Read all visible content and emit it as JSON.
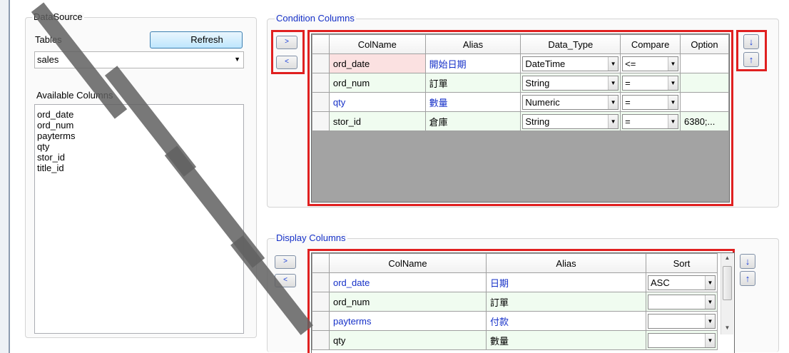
{
  "datasource": {
    "title": "DataSource",
    "tables_label": "Tables",
    "refresh_label": "Refresh",
    "table_value": "sales",
    "available_label": "Available Columns",
    "available_columns": [
      "ord_date",
      "ord_num",
      "payterms",
      "qty",
      "stor_id",
      "title_id"
    ]
  },
  "condition": {
    "title": "Condition Columns",
    "add_label": ">",
    "remove_label": "<",
    "down_label": "↓",
    "up_label": "↑",
    "headers": [
      "ColName",
      "Alias",
      "Data_Type",
      "Compare",
      "Option"
    ],
    "rows": [
      {
        "colname": "ord_date",
        "alias": "開始日期",
        "data_type": "DateTime",
        "compare": "<=",
        "option": ""
      },
      {
        "colname": "ord_num",
        "alias": "訂單",
        "data_type": "String",
        "compare": "=",
        "option": ""
      },
      {
        "colname": "qty",
        "alias": "數量",
        "data_type": "Numeric",
        "compare": "=",
        "option": ""
      },
      {
        "colname": "stor_id",
        "alias": "倉庫",
        "data_type": "String",
        "compare": "=",
        "option": "6380;..."
      }
    ]
  },
  "display": {
    "title": "Display Columns",
    "add_label": ">",
    "remove_label": "<",
    "down_label": "↓",
    "up_label": "↑",
    "headers": [
      "ColName",
      "Alias",
      "Sort"
    ],
    "rows": [
      {
        "colname": "ord_date",
        "alias": "日期",
        "sort": "ASC"
      },
      {
        "colname": "ord_num",
        "alias": "訂單",
        "sort": ""
      },
      {
        "colname": "payterms",
        "alias": "付款",
        "sort": ""
      },
      {
        "colname": "qty",
        "alias": "數量",
        "sort": ""
      }
    ]
  },
  "colors": {
    "highlight_border": "#e02020",
    "accent_text": "#1530c8",
    "grid_background": "#a3a3a3"
  }
}
